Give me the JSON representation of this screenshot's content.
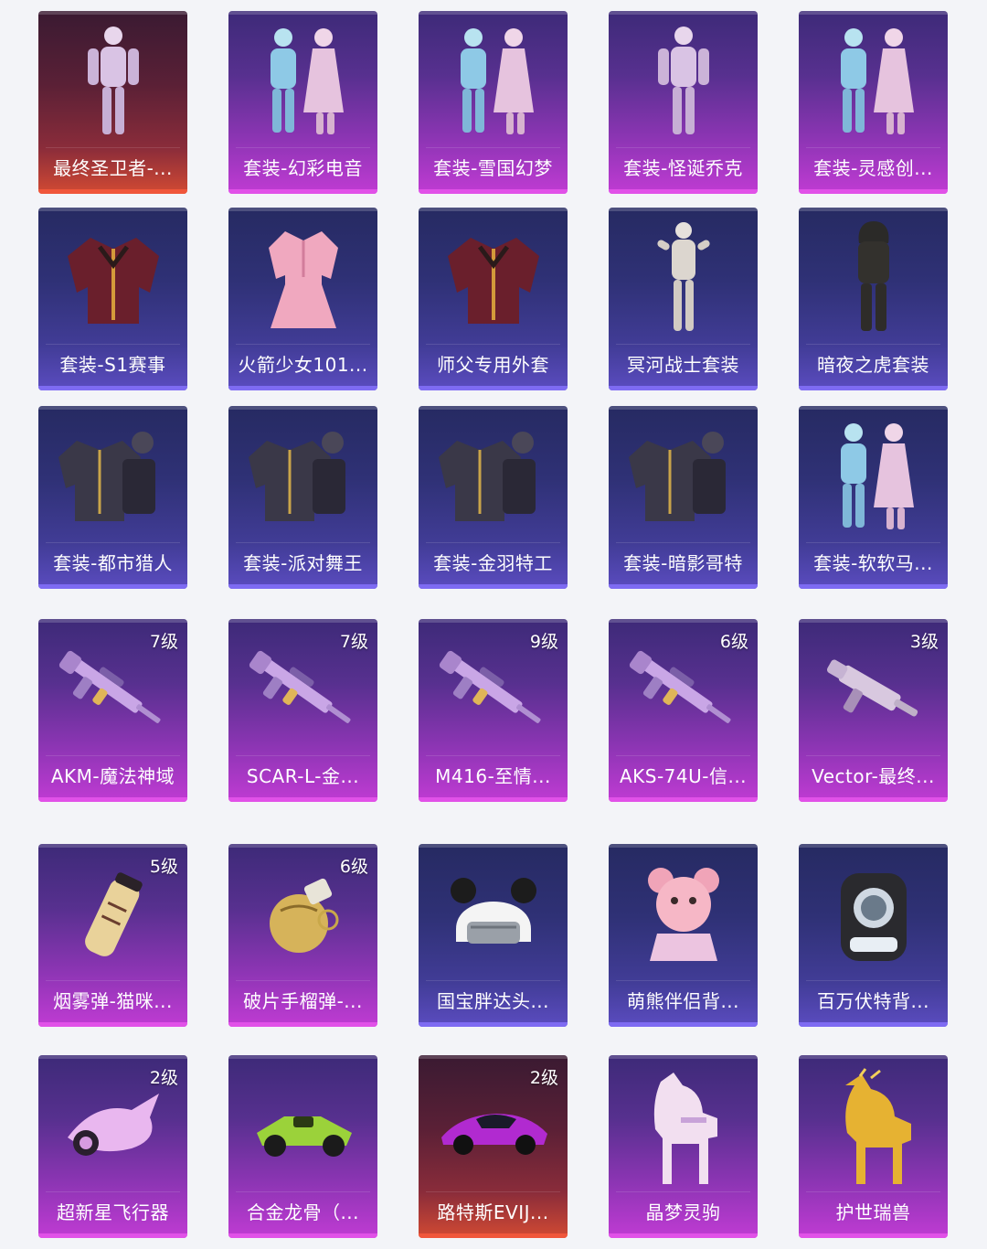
{
  "rows": [
    {
      "items": [
        {
          "label": "最终圣卫者-...",
          "level": "",
          "rarity": "red",
          "icon": "outfit-character-icon"
        },
        {
          "label": "套装-幻彩电音",
          "level": "",
          "rarity": "purple",
          "icon": "outfit-pair-icon"
        },
        {
          "label": "套装-雪国幻梦",
          "level": "",
          "rarity": "purple",
          "icon": "outfit-pair-icon"
        },
        {
          "label": "套装-怪诞乔克",
          "level": "",
          "rarity": "purple",
          "icon": "outfit-character-icon"
        },
        {
          "label": "套装-灵感创...",
          "level": "",
          "rarity": "purple",
          "icon": "outfit-pair-icon"
        }
      ]
    },
    {
      "items": [
        {
          "label": "套装-S1赛事",
          "level": "",
          "rarity": "blue",
          "icon": "jacket-icon"
        },
        {
          "label": "火箭少女101...",
          "level": "",
          "rarity": "blue",
          "icon": "dress-icon"
        },
        {
          "label": "师父专用外套",
          "level": "",
          "rarity": "blue",
          "icon": "jacket-icon"
        },
        {
          "label": "冥河战士套装",
          "level": "",
          "rarity": "blue",
          "icon": "mummy-figure-icon"
        },
        {
          "label": "暗夜之虎套装",
          "level": "",
          "rarity": "blue",
          "icon": "hooded-figure-icon"
        }
      ]
    },
    {
      "items": [
        {
          "label": "套装-都市猎人",
          "level": "",
          "rarity": "blue",
          "icon": "outfit-bundle-icon"
        },
        {
          "label": "套装-派对舞王",
          "level": "",
          "rarity": "blue",
          "icon": "outfit-bundle-icon"
        },
        {
          "label": "套装-金羽特工",
          "level": "",
          "rarity": "blue",
          "icon": "outfit-bundle-icon"
        },
        {
          "label": "套装-暗影哥特",
          "level": "",
          "rarity": "blue",
          "icon": "outfit-bundle-icon"
        },
        {
          "label": "套装-软软马...",
          "level": "",
          "rarity": "blue",
          "icon": "outfit-pair-icon"
        }
      ]
    },
    {
      "items": [
        {
          "label": "AKM-魔法神域",
          "level": "7级",
          "rarity": "purple",
          "icon": "rifle-icon"
        },
        {
          "label": "SCAR-L-金...",
          "level": "7级",
          "rarity": "purple",
          "icon": "rifle-icon"
        },
        {
          "label": "M416-至情...",
          "level": "9级",
          "rarity": "purple",
          "icon": "rifle-icon"
        },
        {
          "label": "AKS-74U-信...",
          "level": "6级",
          "rarity": "purple",
          "icon": "rifle-icon"
        },
        {
          "label": "Vector-最终...",
          "level": "3级",
          "rarity": "purple",
          "icon": "smg-icon"
        }
      ]
    },
    {
      "items": [
        {
          "label": "烟雾弹-猫咪...",
          "level": "5级",
          "rarity": "purple",
          "icon": "smoke-grenade-icon"
        },
        {
          "label": "破片手榴弹-...",
          "level": "6级",
          "rarity": "purple",
          "icon": "frag-grenade-icon"
        },
        {
          "label": "国宝胖达头...",
          "level": "",
          "rarity": "blue",
          "icon": "panda-helmet-icon"
        },
        {
          "label": "萌熊伴侣背...",
          "level": "",
          "rarity": "blue",
          "icon": "bear-backpack-icon"
        },
        {
          "label": "百万伏特背...",
          "level": "",
          "rarity": "blue",
          "icon": "backpack-icon"
        }
      ]
    },
    {
      "items": [
        {
          "label": "超新星飞行器",
          "level": "2级",
          "rarity": "purple",
          "icon": "glider-icon"
        },
        {
          "label": "合金龙骨（...",
          "level": "",
          "rarity": "purple",
          "icon": "race-car-icon"
        },
        {
          "label": "路特斯EVIJ...",
          "level": "2级",
          "rarity": "red",
          "icon": "sports-car-icon"
        },
        {
          "label": "晶梦灵驹",
          "level": "",
          "rarity": "purple",
          "icon": "horse-icon"
        },
        {
          "label": "护世瑞兽",
          "level": "",
          "rarity": "purple",
          "icon": "golden-beast-icon"
        }
      ]
    }
  ]
}
